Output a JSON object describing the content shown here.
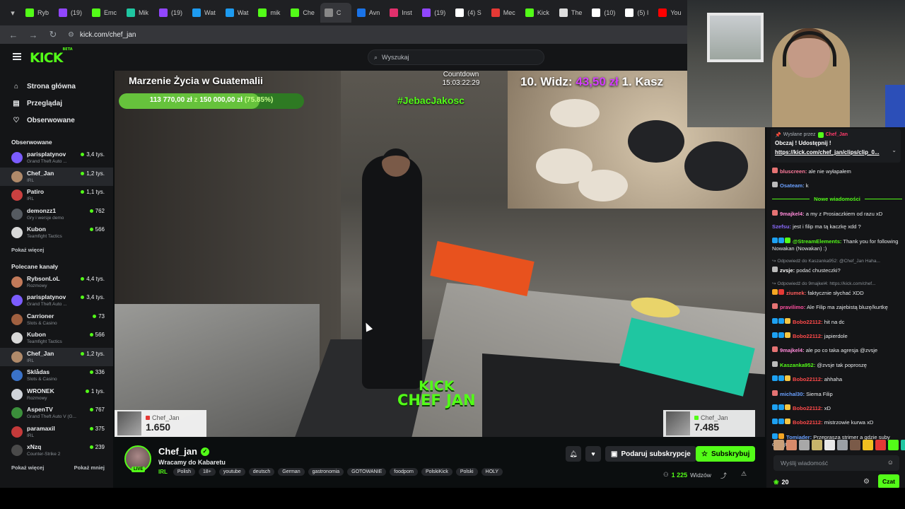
{
  "browser": {
    "tabs": [
      {
        "label": "Ryb",
        "color": "#53fc18"
      },
      {
        "label": "(19)",
        "color": "#9146ff"
      },
      {
        "label": "Emc",
        "color": "#53fc18"
      },
      {
        "label": "Mik",
        "color": "#1fc6a1"
      },
      {
        "label": "(19)",
        "color": "#9146ff"
      },
      {
        "label": "Wat",
        "color": "#1d9bf0"
      },
      {
        "label": "Wat",
        "color": "#1d9bf0"
      },
      {
        "label": "mik",
        "color": "#53fc18"
      },
      {
        "label": "Che",
        "color": "#53fc18"
      },
      {
        "label": "C",
        "color": "#888888"
      },
      {
        "label": "Avn",
        "color": "#1a73e8"
      },
      {
        "label": "Inst",
        "color": "#e1306c"
      },
      {
        "label": "(19)",
        "color": "#9146ff"
      },
      {
        "label": "(4) S",
        "color": "#ffffff"
      },
      {
        "label": "Mec",
        "color": "#e53935"
      },
      {
        "label": "Kick",
        "color": "#53fc18"
      },
      {
        "label": "The",
        "color": "#dddddd"
      },
      {
        "label": "(10)",
        "color": "#ffffff"
      },
      {
        "label": "(5) I",
        "color": "#ffffff"
      },
      {
        "label": "You",
        "color": "#ff0000"
      }
    ],
    "url": "kick.com/chef_jan"
  },
  "header": {
    "logo": "KICK",
    "logo_badge": "BETA",
    "search_placeholder": "Wyszukaj"
  },
  "sidebar": {
    "nav": [
      {
        "label": "Strona główna",
        "icon": "home-icon"
      },
      {
        "label": "Przeglądaj",
        "icon": "browse-icon"
      },
      {
        "label": "Obserwowane",
        "icon": "heart-icon"
      }
    ],
    "followed_title": "Obserwowane",
    "followed": [
      {
        "name": "parisplatynov",
        "cat": "Grand Theft Auto ...",
        "viewers": "3,4 tys.",
        "color": "#7b5cff"
      },
      {
        "name": "Chef_Jan",
        "cat": "IRL",
        "viewers": "1,2 tys.",
        "color": "#b08a6a",
        "selected": true
      },
      {
        "name": "Patiro",
        "cat": "IRL",
        "viewers": "1,1 tys.",
        "color": "#c94040"
      },
      {
        "name": "demonzz1",
        "cat": "Gry i wersje demo",
        "viewers": "762",
        "color": "#555a60"
      },
      {
        "name": "Kubon",
        "cat": "Teamfight Tactics",
        "viewers": "566",
        "color": "#d8d8d8"
      }
    ],
    "followed_more": "Pokaż więcej",
    "recommended_title": "Polecane kanały",
    "recommended": [
      {
        "name": "RybsonLoL",
        "cat": "Rozmowy",
        "viewers": "4,4 tys.",
        "color": "#c27a5a"
      },
      {
        "name": "parisplatynov",
        "cat": "Grand Theft Auto ...",
        "viewers": "3,4 tys.",
        "color": "#7b5cff"
      },
      {
        "name": "Carrioner",
        "cat": "Slots & Casino",
        "viewers": "73",
        "color": "#a06040"
      },
      {
        "name": "Kubon",
        "cat": "Teamfight Tactics",
        "viewers": "566",
        "color": "#d8d8d8"
      },
      {
        "name": "Chef_Jan",
        "cat": "IRL",
        "viewers": "1,2 tys.",
        "color": "#b08a6a",
        "selected": true
      },
      {
        "name": "Sklådas",
        "cat": "Slots & Casino",
        "viewers": "336",
        "color": "#3a72c8"
      },
      {
        "name": "WRONEK",
        "cat": "Rozmowy",
        "viewers": "1 tys.",
        "color": "#d0d4da"
      },
      {
        "name": "AspenTV",
        "cat": "Grand Theft Auto V (G...",
        "viewers": "767",
        "color": "#3b8f3b"
      },
      {
        "name": "paramaxil",
        "cat": "IRL",
        "viewers": "375",
        "color": "#c43a3a"
      },
      {
        "name": "xNzq",
        "cat": "Counter-Strike 2",
        "viewers": "239",
        "color": "#4a4a4a"
      }
    ],
    "rec_more": "Pokaż więcej",
    "rec_less": "Pokaż mniej"
  },
  "video": {
    "overlay_title": "Marzenie Życia w Guatemalii",
    "goal_current": "113 770,00 zł",
    "goal_sep": "z",
    "goal_target": "150 000,00 zł",
    "goal_pct_label": "(75.85%)",
    "goal_fraction": 0.7585,
    "countdown_label": "Countdown",
    "countdown_value": "15:03:22:29",
    "hashtag": "#JebacJakosc",
    "top_text_a": "10. Widz:",
    "top_text_b": "43,50 zł",
    "top_text_c": "1. Kasz",
    "kick_l1": "KICK",
    "kick_l2": "CHEF JAN",
    "card_left": {
      "name": "Chef_Jan",
      "num": "1.650"
    },
    "card_right": {
      "name": "Chef_Jan",
      "num": "7.485"
    }
  },
  "chat": {
    "pinned_by_label": "Wysłane przez",
    "pinned_by_user": "Chef_Jan",
    "pinned_text": "Obczaj ! Udostępnij !",
    "pinned_link": "https://kick.com/chef_jan/clips/clip_0...",
    "messages": [
      {
        "user": "bluscreen",
        "color": "#ff7b9c",
        "body": "ale nie wyłapałem",
        "badges": [
          "#e57373"
        ]
      },
      {
        "user": "Osateam",
        "color": "#6aa0ff",
        "body": "k",
        "badges": [
          "#bbbbbb"
        ]
      },
      {
        "divider": "Nowe wiadomości"
      },
      {
        "user": "9majkel4",
        "color": "#ff8ad8",
        "body": "a my z Prosiaczkiem od razu xD",
        "badges": [
          "#e57373"
        ]
      },
      {
        "user": "Szefsu",
        "color": "#8b6bff",
        "body": "jest i filip ma tą kaczkę xdd ?",
        "badges": []
      },
      {
        "user": "@StreamElements",
        "color": "#53fc18",
        "body": "Thank you for following Nowakan (Nowakan) :)",
        "badges": [
          "#1da1f2",
          "#1da1f2",
          "#53fc18"
        ]
      },
      {
        "reply": "Odpowiedź do Kaszanka952: @Chef_Jan Haha..."
      },
      {
        "user": "zvsje",
        "color": "#ffffff",
        "body": "podać chusteczki?",
        "badges": [
          "#bbbbbb"
        ]
      },
      {
        "reply": "Odpowiedź do 9majkel4: https://kick.com/chef..."
      },
      {
        "user": "ziumek",
        "color": "#ff5c5c",
        "body": "faktycznie słychać XDD",
        "badges": [
          "#f5a623",
          "#e53935"
        ]
      },
      {
        "user": "pravilimo",
        "color": "#ff4fa0",
        "body": "Ale Filip ma zajebistą bluzę/kurtkę",
        "badges": [
          "#e57373"
        ]
      },
      {
        "user": "Bobo22112",
        "color": "#ff4a4a",
        "body": "hit na dc",
        "badges": [
          "#1da1f2",
          "#1da1f2",
          "#f5c542"
        ]
      },
      {
        "user": "Bobo22112",
        "color": "#ff4a4a",
        "body": "japierdole",
        "badges": [
          "#1da1f2",
          "#1da1f2",
          "#f5c542"
        ]
      },
      {
        "user": "9majkel4",
        "color": "#ff8ad8",
        "body": "ale po co taka agresja @zvsje",
        "badges": [
          "#e57373"
        ]
      },
      {
        "user": "Kaszanka952",
        "color": "#53fc18",
        "body": "@zvsje tak poproszę",
        "badges": [
          "#bbbbbb"
        ]
      },
      {
        "user": "Bobo22112",
        "color": "#ff4a4a",
        "body": "ahhaha",
        "badges": [
          "#1da1f2",
          "#1da1f2",
          "#f5c542"
        ]
      },
      {
        "user": "michal30",
        "color": "#6aa0ff",
        "body": "Siema Filip",
        "badges": [
          "#e57373"
        ]
      },
      {
        "user": "Bobo22112",
        "color": "#ff4a4a",
        "body": "xD",
        "badges": [
          "#1da1f2",
          "#1da1f2",
          "#f5c542"
        ]
      },
      {
        "user": "Bobo22112",
        "color": "#ff4a4a",
        "body": "mistrzowie kurwa xD",
        "badges": [
          "#1da1f2",
          "#1da1f2",
          "#f5c542"
        ]
      },
      {
        "user": "Tomiader",
        "color": "#6aa0ff",
        "body": "Przeprasza strimer a gdzie suby donejty",
        "badges": [
          "#1da1f2",
          "#f5a623"
        ]
      }
    ],
    "emote_colors": [
      "#c9a07a",
      "#d88a6a",
      "#a8a8a8",
      "#c7b56b",
      "#e8e8e8",
      "#9aa0a6",
      "#7a5a48",
      "#f0c020",
      "#e53935",
      "#53fc18",
      "#1fc6a1"
    ],
    "input_placeholder": "Wyślij wiadomość",
    "points": "20",
    "send_label": "Czat"
  },
  "channel": {
    "name": "Chef_jan",
    "live": "LIVE",
    "title": "Wracamy do Kabaretu",
    "category": "IRL",
    "tags": [
      "Polish",
      "18+",
      "youtube",
      "deutsch",
      "German",
      "gastronomia",
      "GOTOWANIE",
      "foodporn",
      "PolskiKick",
      "Polski",
      "HOLY"
    ],
    "gift_label": "Podaruj subskrypcje",
    "subscribe_label": "Subskrybuj",
    "viewers_count": "1 225",
    "viewers_label": "Widzów"
  }
}
